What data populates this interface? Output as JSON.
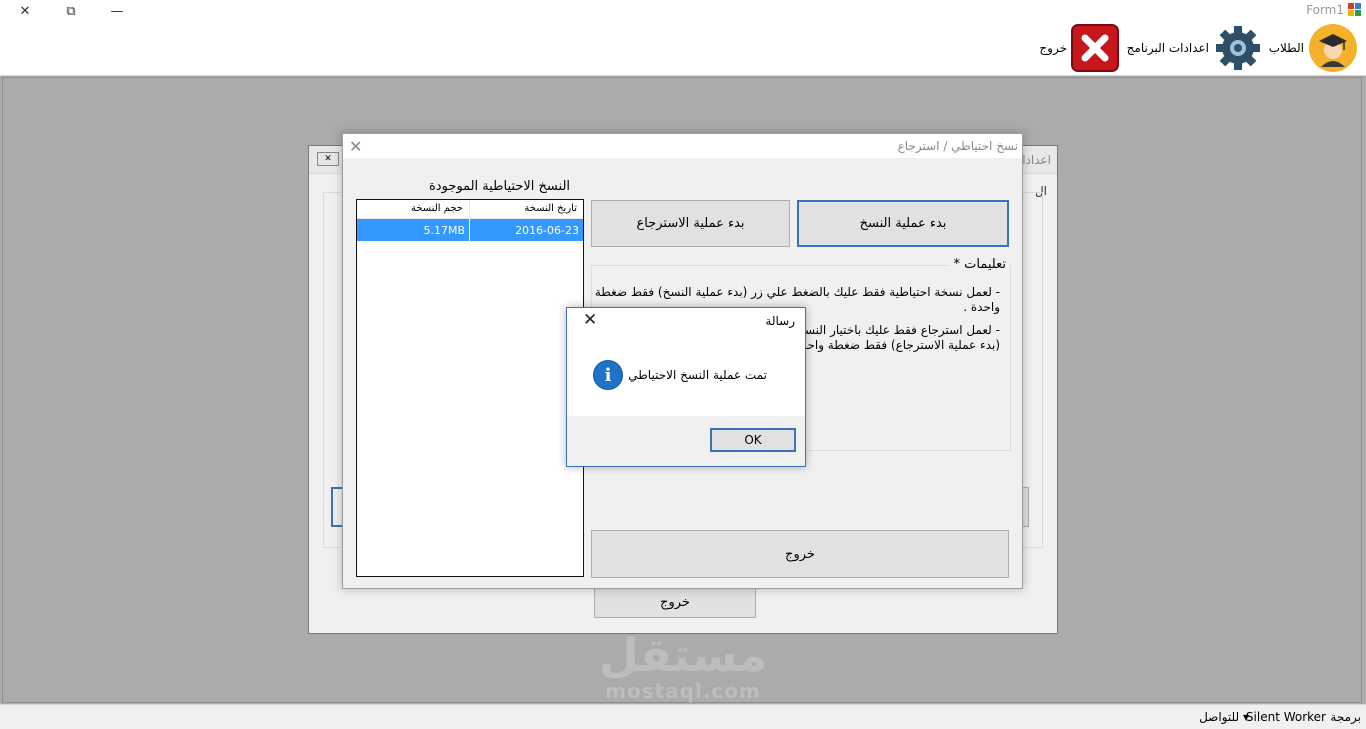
{
  "window": {
    "title": "Form1",
    "close_glyph": "✕",
    "restore_glyph": "⧉",
    "minimize_glyph": "—"
  },
  "toolbar": {
    "students_label": "الطلاب",
    "settings_label": "اعدادات البرنامج",
    "exit_label": "خروج"
  },
  "back_window": {
    "title": "اعدادا",
    "group_letter": "ال",
    "exit_label": "خروج"
  },
  "dialog": {
    "title": "نسخ احتياطي / استرجاع",
    "close_glyph": "✕",
    "list_caption": "النسخ الاحتياطية الموجودة",
    "columns": [
      "تاريخ النسخة",
      "حجم النسخة"
    ],
    "rows": [
      {
        "date": "2016-06-23",
        "size": "5.17MB"
      }
    ],
    "backup_button": "بدء عملية النسخ",
    "restore_button": "بدء عملية الاسترجاع",
    "instructions_title": "* تعليمات",
    "instruction_lines": [
      "- لعمل نسخة احتياطية فقط عليك بالضغط علي زر (بدء عملية النسخ) فقط ضغطة",
      "واحدة .",
      "- لعمل استرجاع فقط عليك باختيار النسخة",
      "(بدء عملية الاسترجاع) فقط ضغطة واحدة"
    ],
    "exit_button": "خروج"
  },
  "message_box": {
    "title": "رسالة",
    "close_glyph": "✕",
    "icon": "info-icon",
    "icon_glyph": "i",
    "message": "تمت عملية النسخ الاحتياطي",
    "ok_label": "OK"
  },
  "watermark": {
    "arabic": "مستقل",
    "latin": "mostaql.com"
  },
  "statusbar": {
    "programming_label": "برمجة",
    "author": "Silent Worker",
    "contact_label": "للتواصل",
    "dropdown_glyph": "▾"
  },
  "colors": {
    "selection": "#3399ff",
    "focus_border": "#3c73b8",
    "mdi_background": "#ababab",
    "exit_icon_red": "#c8161d",
    "info_icon_blue": "#1f74c9"
  }
}
